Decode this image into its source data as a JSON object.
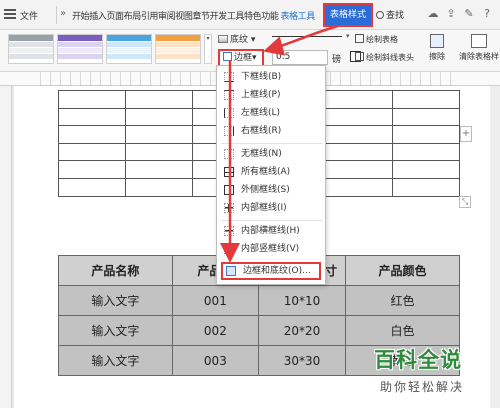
{
  "menubar": {
    "file": "文件",
    "chevrons": "»",
    "tabs": [
      "开始",
      "插入",
      "页面布局",
      "引用",
      "审阅",
      "视图",
      "章节",
      "开发工具",
      "特色功能",
      "表格工具"
    ],
    "active_tab": "表格样式",
    "search": "查找"
  },
  "ribbon": {
    "shading": "底纹",
    "border": "边框",
    "line_width": "0.5",
    "line_width_unit": "磅",
    "draw_table": "绘制表格",
    "draw_diagonal": "绘制斜线表头",
    "eraser": "擦除",
    "clear_style": "清除表格样"
  },
  "border_menu": {
    "items": [
      "下框线(B)",
      "上框线(P)",
      "左框线(L)",
      "右框线(R)",
      "无框线(N)",
      "所有框线(A)",
      "外侧框线(S)",
      "内部框线(I)",
      "内部横框线(H)",
      "内部竖框线(V)",
      "边框和底纹(O)..."
    ]
  },
  "product_table": {
    "headers": [
      "产品名称",
      "产品型",
      "",
      "产品颜色"
    ],
    "header_partial": "寸",
    "rows": [
      [
        "输入文字",
        "001",
        "10*10",
        "红色"
      ],
      [
        "输入文字",
        "002",
        "20*20",
        "白色"
      ],
      [
        "输入文字",
        "003",
        "30*30",
        "黄色"
      ]
    ]
  },
  "watermark": {
    "title": "百科全说",
    "subtitle": "助你轻松解决"
  },
  "colors": {
    "accent": "#2b6cd8",
    "highlight": "#e23a3a",
    "watermark": "#2e8b3a"
  }
}
